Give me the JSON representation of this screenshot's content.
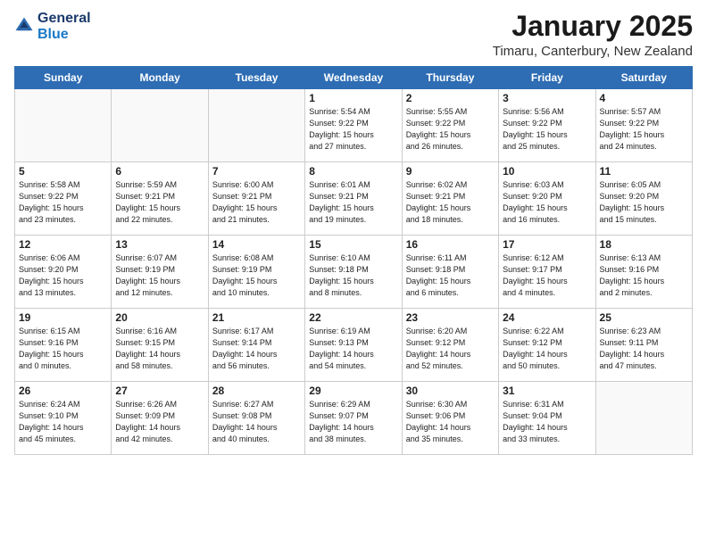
{
  "header": {
    "logo_general": "General",
    "logo_blue": "Blue",
    "month_title": "January 2025",
    "location": "Timaru, Canterbury, New Zealand"
  },
  "weekdays": [
    "Sunday",
    "Monday",
    "Tuesday",
    "Wednesday",
    "Thursday",
    "Friday",
    "Saturday"
  ],
  "weeks": [
    [
      {
        "day": "",
        "info": ""
      },
      {
        "day": "",
        "info": ""
      },
      {
        "day": "",
        "info": ""
      },
      {
        "day": "1",
        "info": "Sunrise: 5:54 AM\nSunset: 9:22 PM\nDaylight: 15 hours\nand 27 minutes."
      },
      {
        "day": "2",
        "info": "Sunrise: 5:55 AM\nSunset: 9:22 PM\nDaylight: 15 hours\nand 26 minutes."
      },
      {
        "day": "3",
        "info": "Sunrise: 5:56 AM\nSunset: 9:22 PM\nDaylight: 15 hours\nand 25 minutes."
      },
      {
        "day": "4",
        "info": "Sunrise: 5:57 AM\nSunset: 9:22 PM\nDaylight: 15 hours\nand 24 minutes."
      }
    ],
    [
      {
        "day": "5",
        "info": "Sunrise: 5:58 AM\nSunset: 9:22 PM\nDaylight: 15 hours\nand 23 minutes."
      },
      {
        "day": "6",
        "info": "Sunrise: 5:59 AM\nSunset: 9:21 PM\nDaylight: 15 hours\nand 22 minutes."
      },
      {
        "day": "7",
        "info": "Sunrise: 6:00 AM\nSunset: 9:21 PM\nDaylight: 15 hours\nand 21 minutes."
      },
      {
        "day": "8",
        "info": "Sunrise: 6:01 AM\nSunset: 9:21 PM\nDaylight: 15 hours\nand 19 minutes."
      },
      {
        "day": "9",
        "info": "Sunrise: 6:02 AM\nSunset: 9:21 PM\nDaylight: 15 hours\nand 18 minutes."
      },
      {
        "day": "10",
        "info": "Sunrise: 6:03 AM\nSunset: 9:20 PM\nDaylight: 15 hours\nand 16 minutes."
      },
      {
        "day": "11",
        "info": "Sunrise: 6:05 AM\nSunset: 9:20 PM\nDaylight: 15 hours\nand 15 minutes."
      }
    ],
    [
      {
        "day": "12",
        "info": "Sunrise: 6:06 AM\nSunset: 9:20 PM\nDaylight: 15 hours\nand 13 minutes."
      },
      {
        "day": "13",
        "info": "Sunrise: 6:07 AM\nSunset: 9:19 PM\nDaylight: 15 hours\nand 12 minutes."
      },
      {
        "day": "14",
        "info": "Sunrise: 6:08 AM\nSunset: 9:19 PM\nDaylight: 15 hours\nand 10 minutes."
      },
      {
        "day": "15",
        "info": "Sunrise: 6:10 AM\nSunset: 9:18 PM\nDaylight: 15 hours\nand 8 minutes."
      },
      {
        "day": "16",
        "info": "Sunrise: 6:11 AM\nSunset: 9:18 PM\nDaylight: 15 hours\nand 6 minutes."
      },
      {
        "day": "17",
        "info": "Sunrise: 6:12 AM\nSunset: 9:17 PM\nDaylight: 15 hours\nand 4 minutes."
      },
      {
        "day": "18",
        "info": "Sunrise: 6:13 AM\nSunset: 9:16 PM\nDaylight: 15 hours\nand 2 minutes."
      }
    ],
    [
      {
        "day": "19",
        "info": "Sunrise: 6:15 AM\nSunset: 9:16 PM\nDaylight: 15 hours\nand 0 minutes."
      },
      {
        "day": "20",
        "info": "Sunrise: 6:16 AM\nSunset: 9:15 PM\nDaylight: 14 hours\nand 58 minutes."
      },
      {
        "day": "21",
        "info": "Sunrise: 6:17 AM\nSunset: 9:14 PM\nDaylight: 14 hours\nand 56 minutes."
      },
      {
        "day": "22",
        "info": "Sunrise: 6:19 AM\nSunset: 9:13 PM\nDaylight: 14 hours\nand 54 minutes."
      },
      {
        "day": "23",
        "info": "Sunrise: 6:20 AM\nSunset: 9:12 PM\nDaylight: 14 hours\nand 52 minutes."
      },
      {
        "day": "24",
        "info": "Sunrise: 6:22 AM\nSunset: 9:12 PM\nDaylight: 14 hours\nand 50 minutes."
      },
      {
        "day": "25",
        "info": "Sunrise: 6:23 AM\nSunset: 9:11 PM\nDaylight: 14 hours\nand 47 minutes."
      }
    ],
    [
      {
        "day": "26",
        "info": "Sunrise: 6:24 AM\nSunset: 9:10 PM\nDaylight: 14 hours\nand 45 minutes."
      },
      {
        "day": "27",
        "info": "Sunrise: 6:26 AM\nSunset: 9:09 PM\nDaylight: 14 hours\nand 42 minutes."
      },
      {
        "day": "28",
        "info": "Sunrise: 6:27 AM\nSunset: 9:08 PM\nDaylight: 14 hours\nand 40 minutes."
      },
      {
        "day": "29",
        "info": "Sunrise: 6:29 AM\nSunset: 9:07 PM\nDaylight: 14 hours\nand 38 minutes."
      },
      {
        "day": "30",
        "info": "Sunrise: 6:30 AM\nSunset: 9:06 PM\nDaylight: 14 hours\nand 35 minutes."
      },
      {
        "day": "31",
        "info": "Sunrise: 6:31 AM\nSunset: 9:04 PM\nDaylight: 14 hours\nand 33 minutes."
      },
      {
        "day": "",
        "info": ""
      }
    ]
  ]
}
